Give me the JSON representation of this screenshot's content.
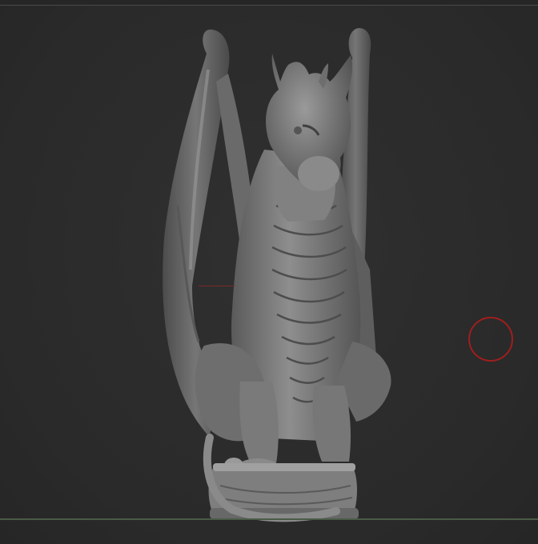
{
  "viewport": {
    "background": "#2c2c2c",
    "model_color": "#7b7b7b",
    "brush_cursor_color": "#a01e1e",
    "floor_line_color": "#4a5a45"
  },
  "icons": {
    "brush_cursor": "brush-cursor-circle"
  }
}
